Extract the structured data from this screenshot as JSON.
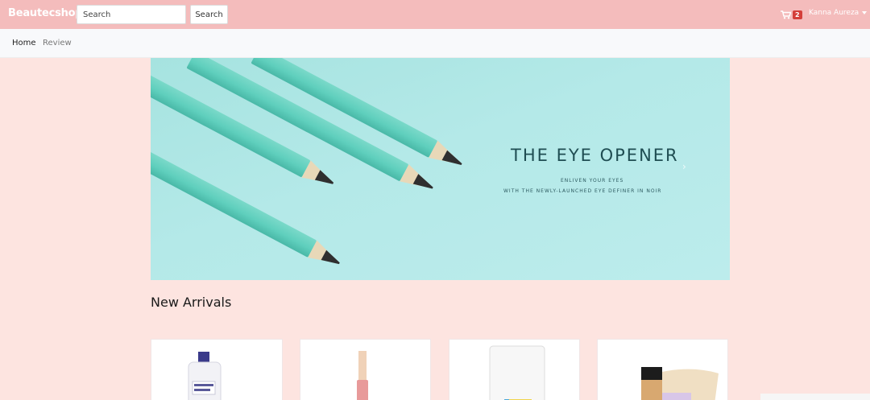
{
  "navbar": {
    "brand": "Beautecshop",
    "search_placeholder": "Search",
    "search_button": "Search",
    "cart_icon": "cart-icon",
    "cart_count": "2",
    "user_name": "Kanna Aureza"
  },
  "subnav": {
    "items": [
      {
        "label": "Home"
      },
      {
        "label": "Review"
      }
    ]
  },
  "banner": {
    "title": "THE EYE OPENER",
    "line1": "ENLIVEN YOUR EYES",
    "line2": "WITH THE NEWLY-LAUNCHED EYE DEFINER IN NOIR",
    "next_icon": "chevron-right-icon",
    "colors": {
      "background": "#b4e9e8",
      "pencil": "#5fcfbd",
      "tip": "#2f2f2f"
    }
  },
  "section": {
    "title": "New Arrivals"
  },
  "products": [
    {
      "image": "toner-bottle"
    },
    {
      "image": "lip-tint-tube"
    },
    {
      "image": "cleanser-tube"
    },
    {
      "image": "foundation-stick"
    }
  ],
  "colors": {
    "navbar": "#f4bcbc",
    "page": "#fde4e0",
    "badge": "#d43f3a"
  }
}
